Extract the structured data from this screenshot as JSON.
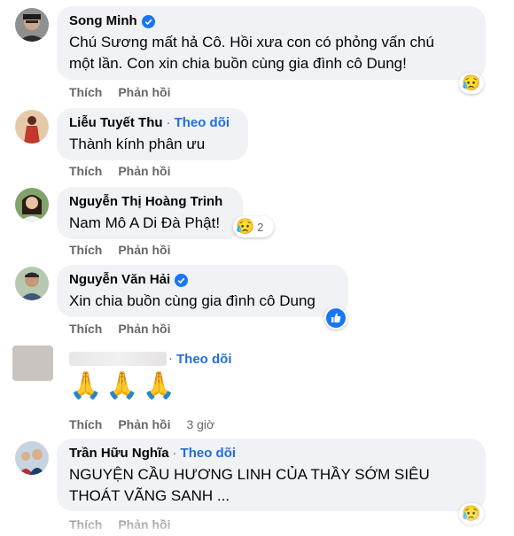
{
  "actions": {
    "like": "Thích",
    "reply": "Phản hồi"
  },
  "comments": [
    {
      "author": "Song Minh",
      "verified": true,
      "text_lines": [
        "Chú Sương mất hả Cô. Hồi xưa con có phỏng vấn chú",
        "một lần. Con xin chia buồn cùng gia đình cô Dung!"
      ],
      "reaction": "sad"
    },
    {
      "author": "Liễu Tuyết Thu",
      "follow": "Theo dõi",
      "text_lines": [
        "Thành kính phân ưu"
      ]
    },
    {
      "author": "Nguyễn Thị Hoàng Trinh",
      "text_lines": [
        "Nam Mô A Di Đà Phật!"
      ],
      "reaction": "sad",
      "reaction_count": "2"
    },
    {
      "author": "Nguyễn Văn Hải",
      "verified": true,
      "text_lines": [
        "Xin chia buồn cùng gia đình cô Dung"
      ],
      "reaction": "like"
    },
    {
      "author": "",
      "follow": "Theo dõi",
      "text_lines": [
        "🙏🙏🙏"
      ],
      "time": "3 giờ"
    },
    {
      "author": "Trần Hữu Nghĩa",
      "follow": "Theo dõi",
      "text_lines": [
        "NGUYỆN CẦU HƯƠNG LINH CỦA THẦY SỚM SIÊU",
        "THOÁT VÃNG SANH ..."
      ],
      "reaction": "sad"
    }
  ],
  "colors": {
    "bubble": "#f0f2f5",
    "link": "#216fdb",
    "muted": "#65676b",
    "verified": "#1877f2"
  }
}
